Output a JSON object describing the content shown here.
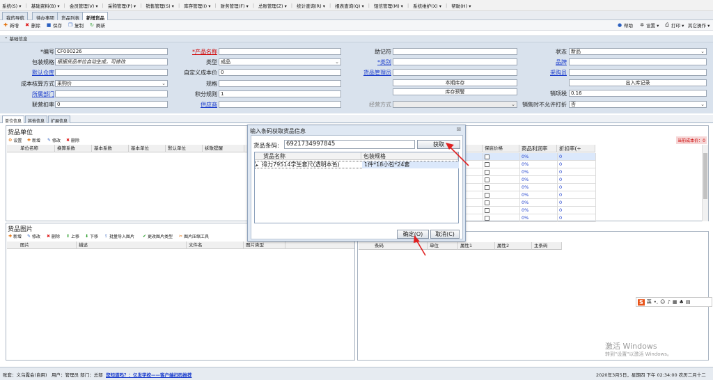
{
  "menu": [
    "系统(S) ▾",
    "基础资料(B) ▾",
    "会员管理(V) ▾",
    "采购管理(P) ▾",
    "销售管理(S) ▾",
    "库存管理(I) ▾",
    "财务管理(F) ▾",
    "总账管理(Z) ▾",
    "统计查询(R) ▾",
    "报表查询(Q) ▾",
    "短信管理(M) ▾",
    "系统维护(X) ▾",
    "帮助(H) ▾"
  ],
  "tabs": [
    "我的导航",
    "待办事项",
    "货品列表",
    "新增货品"
  ],
  "window_close": "×",
  "window_down": "▼",
  "toolbar": {
    "new": "新增",
    "delete": "删除",
    "save": "保存",
    "copy": "复制",
    "refresh": "刷新",
    "help": "帮助",
    "settings": "设置 ▾",
    "print": "打印 ▾",
    "other": "其它操作 ▾"
  },
  "section_title": "基础信息",
  "form": {
    "code_label": "*编号",
    "code_value": "CF000226",
    "spec_label": "包装规格",
    "spec_value": "根据货品单位自动生成，可修改",
    "warehouse_label": "默认仓库",
    "warehouse_value": "",
    "cost_method_label": "成本核算方式",
    "cost_method_value": "采购价",
    "dept_label": "所属部门",
    "dept_value": "",
    "joint_discount_label": "联营扣率",
    "joint_discount_value": "0",
    "name_label": "*产品名称",
    "name_value": "",
    "type_label": "类型",
    "type_value": "成品",
    "custom_cost_label": "自定义成本价",
    "custom_cost_value": "0",
    "model_label": "规格",
    "model_value": "",
    "points_label": "积分规则",
    "points_value": "1",
    "supplier_label": "供应商",
    "supplier_value": "",
    "mnemonic_label": "助记符",
    "mnemonic_value": "",
    "category_label": "*类别",
    "category_value": "",
    "manager_label": "货品管理员",
    "manager_value": "",
    "stock_btn": "本期库存",
    "warning_btn": "库存预警",
    "business_label": "经营方式",
    "business_value": "",
    "status_label": "状态",
    "status_value": "新品",
    "brand_label": "品牌",
    "brand_value": "",
    "buyer_label": "采购员",
    "buyer_value": "",
    "io_btn": "出入库记录",
    "tax_label": "销项税",
    "tax_value": "0.16",
    "no_discount_label": "销售时不允许打折",
    "no_discount_value": "否"
  },
  "bottom_tabs": [
    "单位信息",
    "其他信息",
    "扩展信息"
  ],
  "units_panel": {
    "title": "货品单位",
    "tools": [
      "设置",
      "新增",
      "修改",
      "删除"
    ],
    "columns": [
      "单位名称",
      "换算系数",
      "基本系数",
      "基本单位",
      "默认单位",
      "拆散提醒"
    ]
  },
  "images_panel": {
    "title": "货品图片",
    "tools": [
      "新增",
      "修改",
      "删除",
      "上移",
      "下移",
      "批量导入图片",
      "更改图片类型",
      "图片压缩工具"
    ],
    "columns": [
      "图片",
      "描述",
      "文件名",
      "图片类型"
    ]
  },
  "price_panel": {
    "cost_label": "当前成本价：0",
    "columns": [
      "",
      "保底价格",
      "商品利润率",
      "折扣率(÷"
    ],
    "rows": [
      [
        "",
        "0%",
        "0"
      ],
      [
        "",
        "0%",
        "0"
      ],
      [
        "",
        "0%",
        "0"
      ],
      [
        "",
        "0%",
        "0"
      ],
      [
        "",
        "0%",
        "0"
      ],
      [
        "",
        "0%",
        "0"
      ],
      [
        "",
        "0%",
        "0"
      ],
      [
        "",
        "0%",
        "0"
      ],
      [
        "",
        "0%",
        "0"
      ]
    ]
  },
  "barcode_panel": {
    "columns": [
      "条码",
      "单位",
      "属性1",
      "属性2",
      "主条码"
    ]
  },
  "dialog": {
    "title": "输入条码获取货品信息",
    "close": "☒",
    "barcode_label": "货品条码:",
    "barcode_value": "6921734997845",
    "fetch_btn": "获取",
    "columns": [
      "货品名称",
      "包装规格"
    ],
    "row": {
      "name": "得力79514学生套尺(透明本色)",
      "spec": "1件*18小包*24套"
    },
    "ok_btn": "确定(O)",
    "cancel_btn": "取消(C)"
  },
  "status": {
    "company": "账套：义乌露会(自用)",
    "user": "用户：管理员 部门：总部",
    "link": "您知道吗？：亿发学校——客户端扫码推荐",
    "datetime": "2020年3月5日，星期四 下午 02:34:00 农历二月十二"
  },
  "watermark": {
    "line1": "激活 Windows",
    "line2": "转到\"设置\"以激活 Windows。"
  },
  "ime": {
    "label": "英"
  }
}
